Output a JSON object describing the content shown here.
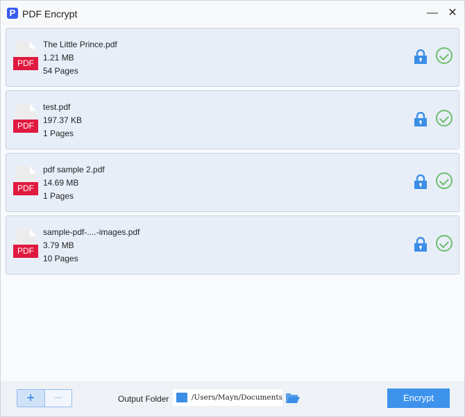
{
  "app": {
    "title": "PDF Encrypt",
    "logo_letter": "P"
  },
  "files": [
    {
      "name": "The Little Prince.pdf",
      "size": "1.21 MB",
      "pages": "54 Pages",
      "type_label": "PDF"
    },
    {
      "name": "test.pdf",
      "size": "197.37 KB",
      "pages": "1 Pages",
      "type_label": "PDF"
    },
    {
      "name": "pdf sample 2.pdf",
      "size": "14.69 MB",
      "pages": "1 Pages",
      "type_label": "PDF"
    },
    {
      "name": "sample-pdf-....-images.pdf",
      "size": "3.79 MB",
      "pages": "10 Pages",
      "type_label": "PDF"
    }
  ],
  "bottom": {
    "add": "+",
    "remove": "−",
    "output_label": "Output Folder",
    "output_path": "/Users/Mayn/Documents",
    "encrypt": "Encrypt"
  },
  "colors": {
    "accent": "#3d92ec",
    "pdf": "#e0193f",
    "check": "#6cbf6c"
  }
}
